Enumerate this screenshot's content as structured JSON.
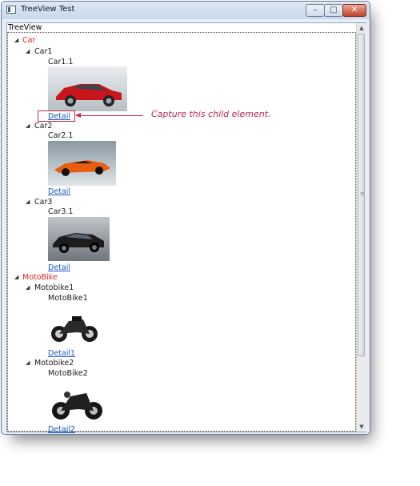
{
  "window": {
    "title": "TreeView Test"
  },
  "treeview": {
    "header": "TreeView",
    "groups": [
      {
        "label": "Car",
        "children": [
          {
            "label": "Car1",
            "item": "Car1.1",
            "link": "Detail"
          },
          {
            "label": "Car2",
            "item": "Car2.1",
            "link": "Detail"
          },
          {
            "label": "Car3",
            "item": "Car3.1",
            "link": "Detail"
          }
        ]
      },
      {
        "label": "MotoBike",
        "children": [
          {
            "label": "Motobike1",
            "item": "MotoBike1",
            "link": "Detail1"
          },
          {
            "label": "Motobike2",
            "item": "MotoBike2",
            "link": "Detail2"
          }
        ]
      }
    ]
  },
  "annotation": {
    "text": "Capture this child element."
  },
  "colors": {
    "category": "#e8221e",
    "link": "#1a56c5",
    "annotation": "#c0294b"
  }
}
